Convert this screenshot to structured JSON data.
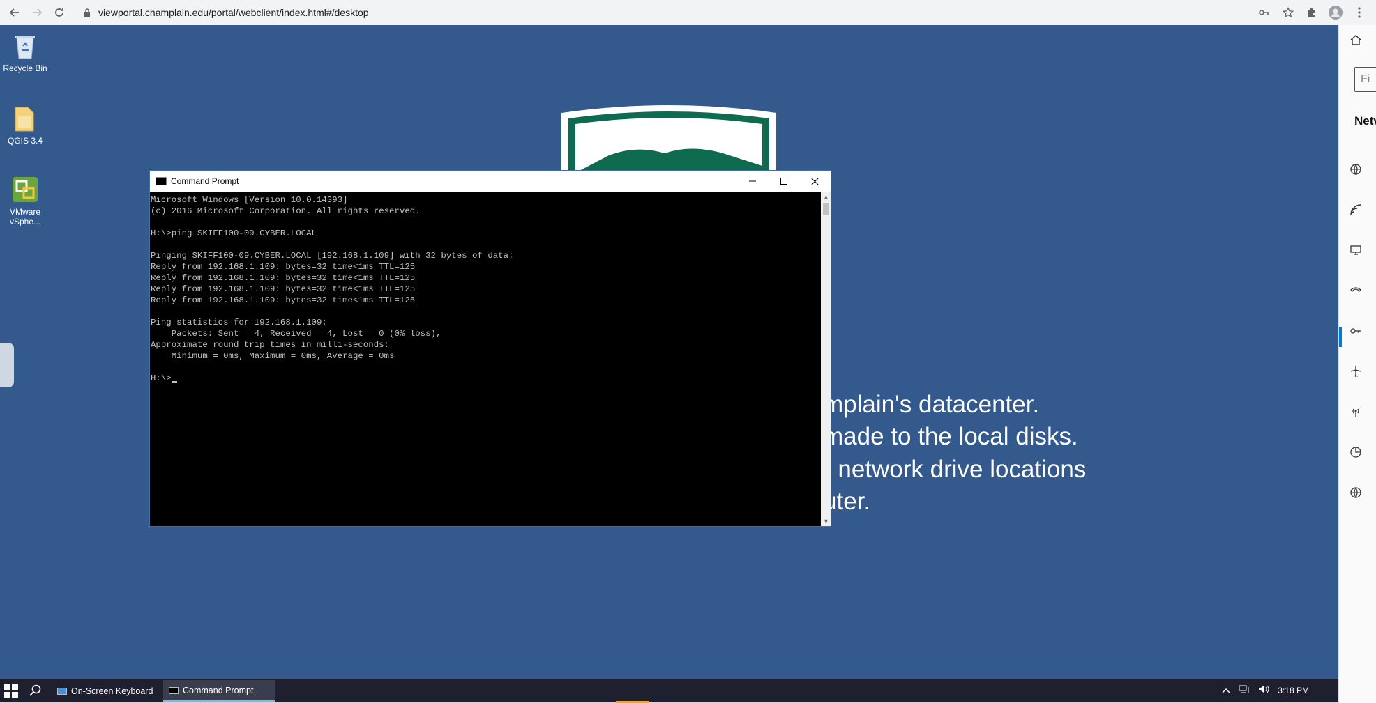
{
  "browser": {
    "url": "viewportal.champlain.edu/portal/webclient/index.html#/desktop"
  },
  "desktop": {
    "icons": [
      {
        "label": "Recycle Bin"
      },
      {
        "label": "QGIS 3.4"
      },
      {
        "label": "VMware vSphe..."
      }
    ],
    "background_lines": [
      "mplain's datacenter.",
      "made to the local disks.",
      "r network drive locations",
      "uter."
    ]
  },
  "cmd_window": {
    "title": "Command Prompt",
    "lines": [
      "Microsoft Windows [Version 10.0.14393]",
      "(c) 2016 Microsoft Corporation. All rights reserved.",
      "",
      "H:\\>ping SKIFF100-09.CYBER.LOCAL",
      "",
      "Pinging SKIFF100-09.CYBER.LOCAL [192.168.1.109] with 32 bytes of data:",
      "Reply from 192.168.1.109: bytes=32 time<1ms TTL=125",
      "Reply from 192.168.1.109: bytes=32 time<1ms TTL=125",
      "Reply from 192.168.1.109: bytes=32 time<1ms TTL=125",
      "Reply from 192.168.1.109: bytes=32 time<1ms TTL=125",
      "",
      "Ping statistics for 192.168.1.109:",
      "    Packets: Sent = 4, Received = 4, Lost = 0 (0% loss),",
      "Approximate round trip times in milli-seconds:",
      "    Minimum = 0ms, Maximum = 0ms, Average = 0ms",
      ""
    ],
    "prompt": "H:\\>"
  },
  "taskbar": {
    "items": [
      {
        "label": "On-Screen Keyboard"
      },
      {
        "label": "Command Prompt"
      }
    ],
    "clock": "3:18 PM"
  },
  "side_panel": {
    "find_placeholder": "Fi",
    "heading": "Netv"
  },
  "colors": {
    "desktop_bg": "#34598c",
    "taskbar_bg": "#1e2030",
    "logo_green": "#0f6b50"
  }
}
